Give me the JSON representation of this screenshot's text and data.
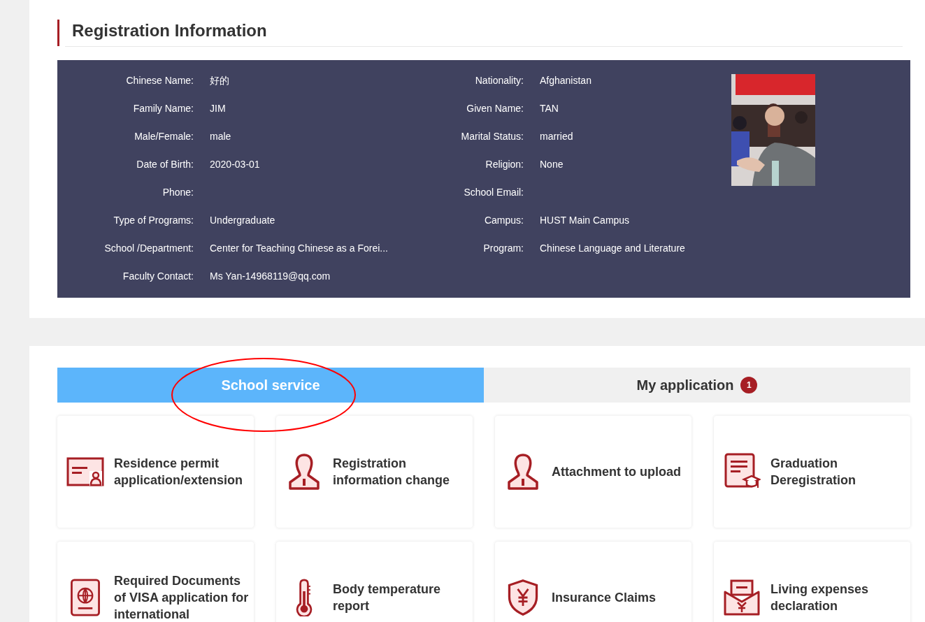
{
  "section_title": "Registration Information",
  "info_fields": [
    {
      "label": "Chinese Name:",
      "value": "好的"
    },
    {
      "label": "Nationality:",
      "value": "Afghanistan"
    },
    {
      "label": "Family Name:",
      "value": "JIM"
    },
    {
      "label": "Given Name:",
      "value": "TAN"
    },
    {
      "label": "Male/Female:",
      "value": "male"
    },
    {
      "label": "Marital Status:",
      "value": "married"
    },
    {
      "label": "Date of Birth:",
      "value": "2020-03-01"
    },
    {
      "label": "Religion:",
      "value": "None"
    },
    {
      "label": "Phone:"
    },
    {
      "label": "School Email:"
    },
    {
      "label": "Type of Programs:",
      "value": "Undergraduate"
    },
    {
      "label": "Campus:",
      "value": "HUST Main Campus"
    },
    {
      "label": "School /Department:",
      "value": "Center for Teaching Chinese as a Forei..."
    },
    {
      "label": "Program:",
      "value": "Chinese Language and Literature"
    },
    {
      "label": "Faculty Contact:",
      "value": "Ms Yan-14968119@qq.com"
    }
  ],
  "tabs": [
    {
      "label": "School service",
      "selected": true
    },
    {
      "label": "My application",
      "selected": false,
      "badge": "1"
    }
  ],
  "annotation": {
    "kind": "ellipse",
    "color": "#ff0000"
  },
  "services": [
    {
      "label": "Residence permit application/extension"
    },
    {
      "label": "Registration information change"
    },
    {
      "label": "Attachment to upload"
    },
    {
      "label": "Graduation Deregistration"
    },
    {
      "label": "Required Documents of VISA application for international"
    },
    {
      "label": "Body temperature report"
    },
    {
      "label": "Insurance Claims"
    },
    {
      "label": "Living expenses declaration"
    }
  ]
}
